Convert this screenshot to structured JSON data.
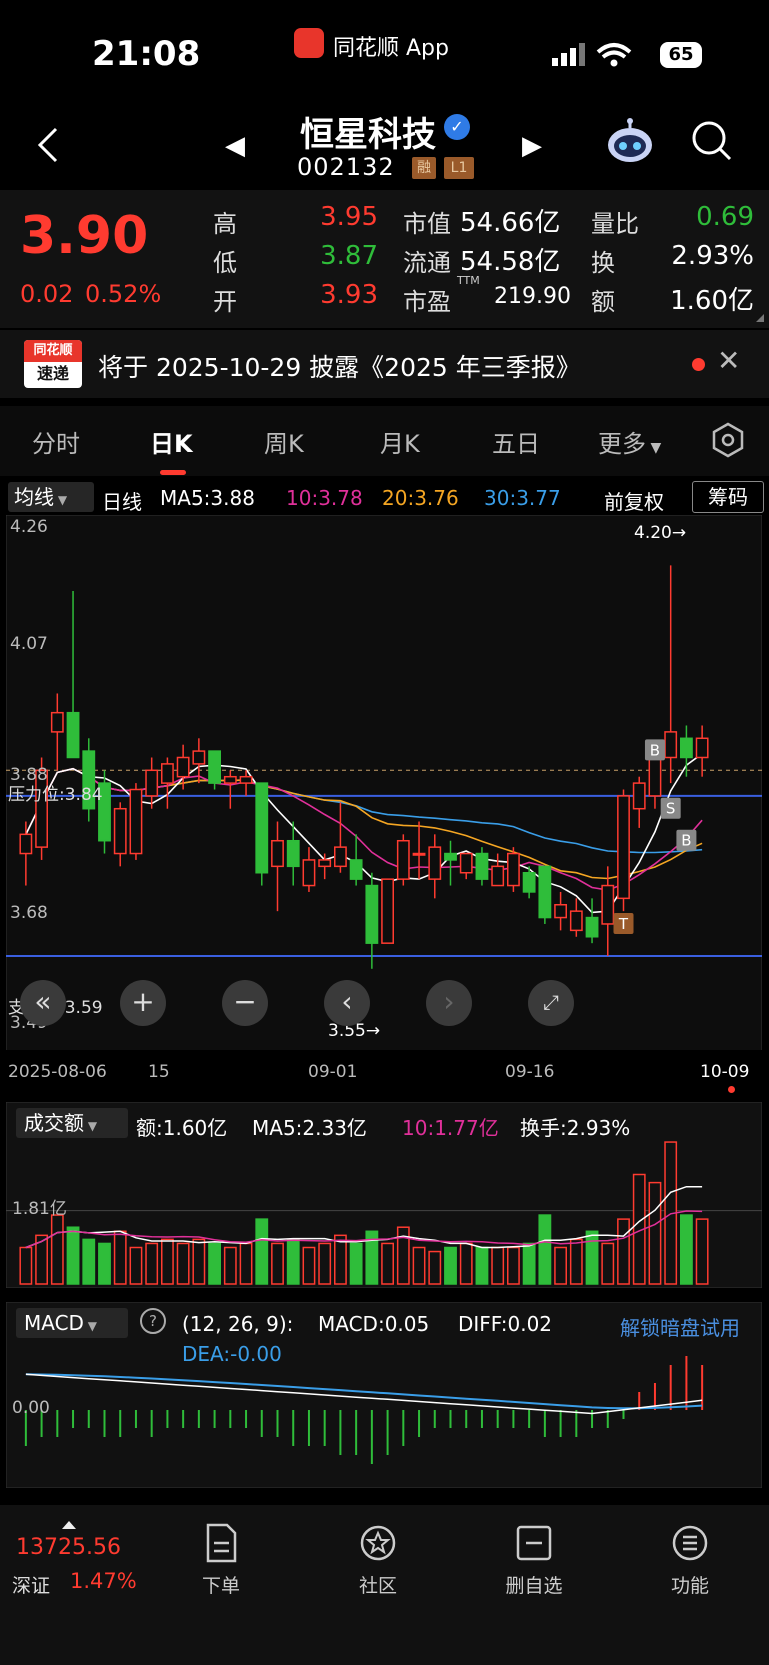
{
  "status_bar": {
    "time": "21:08",
    "app_name": "同花顺 App",
    "battery": "65"
  },
  "header": {
    "stock_name": "恒星科技",
    "stock_code": "002132",
    "tags": [
      "融",
      "L1"
    ]
  },
  "quote": {
    "last_price": "3.90",
    "change": "0.02",
    "change_pct": "0.52%",
    "high_label": "高",
    "high": "3.95",
    "low_label": "低",
    "low": "3.87",
    "open_label": "开",
    "open": "3.93",
    "mktcap_label": "市值",
    "mktcap": "54.66亿",
    "float_label": "流通",
    "float": "54.58亿",
    "pe_label": "市盈",
    "pe_sup": "TTM",
    "pe": "219.90",
    "volratio_label": "量比",
    "volratio": "0.69",
    "turnover_label": "换",
    "turnover": "2.93%",
    "amount_label": "额",
    "amount": "1.60亿"
  },
  "notice": {
    "logo_line1": "同花顺",
    "logo_line2": "速递",
    "text": "将于 2025-10-29 披露《2025 年三季报》"
  },
  "tabs": [
    "分时",
    "日K",
    "周K",
    "月K",
    "五日",
    "更多"
  ],
  "ma_legend": {
    "selector": "均线",
    "period": "日线",
    "ma5": "MA5:3.88",
    "ma10": "10:3.78",
    "ma20": "20:3.76",
    "ma30": "30:3.77",
    "adjust": "前复权",
    "chips": "筹码",
    "colors": {
      "ma5": "#ffffff",
      "ma10": "#e0309a",
      "ma20": "#f5a623",
      "ma30": "#3a9ee8"
    }
  },
  "kline": {
    "y_ticks": [
      "4.26",
      "4.07",
      "3.88",
      "3.68",
      "3.49"
    ],
    "resistance_label": "压力位:3.84",
    "support_label": "支撑位:3.59",
    "max_marker": "4.20→",
    "min_marker": "3.55→",
    "x_labels": [
      "2025-08-06",
      "15",
      "09-01",
      "09-16",
      "10-09"
    ],
    "signals": [
      "B",
      "S",
      "B",
      "T"
    ]
  },
  "chart_data": {
    "type": "candlestick",
    "ylim": [
      3.49,
      4.26
    ],
    "resistance": 3.84,
    "support": 3.59,
    "candles": [
      {
        "o": 3.75,
        "h": 3.8,
        "l": 3.7,
        "c": 3.78
      },
      {
        "o": 3.76,
        "h": 3.9,
        "l": 3.74,
        "c": 3.88
      },
      {
        "o": 3.94,
        "h": 4.0,
        "l": 3.88,
        "c": 3.97
      },
      {
        "o": 3.97,
        "h": 4.16,
        "l": 3.9,
        "c": 3.9
      },
      {
        "o": 3.91,
        "h": 3.93,
        "l": 3.8,
        "c": 3.82
      },
      {
        "o": 3.86,
        "h": 3.88,
        "l": 3.75,
        "c": 3.77
      },
      {
        "o": 3.75,
        "h": 3.83,
        "l": 3.73,
        "c": 3.82
      },
      {
        "o": 3.75,
        "h": 3.86,
        "l": 3.74,
        "c": 3.85
      },
      {
        "o": 3.84,
        "h": 3.9,
        "l": 3.82,
        "c": 3.88
      },
      {
        "o": 3.86,
        "h": 3.9,
        "l": 3.82,
        "c": 3.89
      },
      {
        "o": 3.87,
        "h": 3.92,
        "l": 3.85,
        "c": 3.9
      },
      {
        "o": 3.89,
        "h": 3.93,
        "l": 3.86,
        "c": 3.91
      },
      {
        "o": 3.91,
        "h": 3.91,
        "l": 3.85,
        "c": 3.86
      },
      {
        "o": 3.86,
        "h": 3.88,
        "l": 3.82,
        "c": 3.87
      },
      {
        "o": 3.86,
        "h": 3.88,
        "l": 3.84,
        "c": 3.87
      },
      {
        "o": 3.86,
        "h": 3.86,
        "l": 3.7,
        "c": 3.72
      },
      {
        "o": 3.73,
        "h": 3.8,
        "l": 3.66,
        "c": 3.77
      },
      {
        "o": 3.77,
        "h": 3.8,
        "l": 3.7,
        "c": 3.73
      },
      {
        "o": 3.7,
        "h": 3.76,
        "l": 3.69,
        "c": 3.74
      },
      {
        "o": 3.73,
        "h": 3.75,
        "l": 3.71,
        "c": 3.74
      },
      {
        "o": 3.73,
        "h": 3.83,
        "l": 3.72,
        "c": 3.76
      },
      {
        "o": 3.74,
        "h": 3.78,
        "l": 3.7,
        "c": 3.71
      },
      {
        "o": 3.7,
        "h": 3.72,
        "l": 3.57,
        "c": 3.61
      },
      {
        "o": 3.61,
        "h": 3.71,
        "l": 3.61,
        "c": 3.71
      },
      {
        "o": 3.71,
        "h": 3.78,
        "l": 3.7,
        "c": 3.77
      },
      {
        "o": 3.75,
        "h": 3.8,
        "l": 3.71,
        "c": 3.75
      },
      {
        "o": 3.71,
        "h": 3.78,
        "l": 3.68,
        "c": 3.76
      },
      {
        "o": 3.75,
        "h": 3.77,
        "l": 3.7,
        "c": 3.74
      },
      {
        "o": 3.72,
        "h": 3.75,
        "l": 3.71,
        "c": 3.75
      },
      {
        "o": 3.75,
        "h": 3.76,
        "l": 3.7,
        "c": 3.71
      },
      {
        "o": 3.7,
        "h": 3.75,
        "l": 3.7,
        "c": 3.73
      },
      {
        "o": 3.7,
        "h": 3.76,
        "l": 3.69,
        "c": 3.75
      },
      {
        "o": 3.72,
        "h": 3.73,
        "l": 3.68,
        "c": 3.69
      },
      {
        "o": 3.73,
        "h": 3.73,
        "l": 3.64,
        "c": 3.65
      },
      {
        "o": 3.65,
        "h": 3.69,
        "l": 3.63,
        "c": 3.67
      },
      {
        "o": 3.63,
        "h": 3.68,
        "l": 3.62,
        "c": 3.66
      },
      {
        "o": 3.65,
        "h": 3.68,
        "l": 3.61,
        "c": 3.62
      },
      {
        "o": 3.64,
        "h": 3.73,
        "l": 3.59,
        "c": 3.7
      },
      {
        "o": 3.68,
        "h": 3.85,
        "l": 3.66,
        "c": 3.84
      },
      {
        "o": 3.82,
        "h": 3.87,
        "l": 3.79,
        "c": 3.86
      },
      {
        "o": 3.84,
        "h": 3.91,
        "l": 3.82,
        "c": 3.9
      },
      {
        "o": 3.9,
        "h": 4.2,
        "l": 3.86,
        "c": 3.94
      },
      {
        "o": 3.93,
        "h": 3.95,
        "l": 3.87,
        "c": 3.9
      },
      {
        "o": 3.9,
        "h": 3.95,
        "l": 3.87,
        "c": 3.93
      }
    ],
    "volume": [
      0.9,
      1.2,
      1.7,
      1.4,
      1.1,
      1.0,
      1.3,
      0.9,
      1.0,
      1.1,
      1.0,
      1.1,
      1.0,
      0.9,
      1.0,
      1.6,
      1.0,
      1.1,
      0.9,
      1.0,
      1.2,
      1.0,
      1.3,
      1.0,
      1.4,
      0.9,
      0.8,
      0.9,
      1.0,
      0.9,
      0.9,
      0.9,
      1.0,
      1.7,
      0.9,
      1.1,
      1.3,
      1.0,
      1.6,
      2.7,
      2.5,
      3.5,
      1.7,
      1.6
    ],
    "macd_hist": [
      -0.04,
      -0.03,
      -0.03,
      -0.02,
      -0.02,
      -0.03,
      -0.03,
      -0.02,
      -0.03,
      -0.02,
      -0.02,
      -0.02,
      -0.02,
      -0.02,
      -0.02,
      -0.03,
      -0.03,
      -0.04,
      -0.04,
      -0.04,
      -0.05,
      -0.05,
      -0.06,
      -0.05,
      -0.04,
      -0.03,
      -0.02,
      -0.02,
      -0.02,
      -0.02,
      -0.02,
      -0.02,
      -0.02,
      -0.03,
      -0.03,
      -0.03,
      -0.02,
      -0.02,
      -0.01,
      0.02,
      0.03,
      0.05,
      0.06,
      0.05
    ]
  },
  "volume_panel": {
    "selector": "成交额",
    "amount": "额:1.60亿",
    "ma5": "MA5:2.33亿",
    "ma10": "10:1.77亿",
    "turnover": "换手:2.93%",
    "y_tick": "1.81亿"
  },
  "macd_panel": {
    "selector": "MACD",
    "params": "(12, 26, 9):",
    "macd": "MACD:0.05",
    "diff": "DIFF:0.02",
    "dea": "DEA:-0.00",
    "unlock": "解锁暗盘试用",
    "y_tick": "0.00"
  },
  "bottom_nav": {
    "index_value": "13725.56",
    "index_name": "深证",
    "index_pct": "1.47%",
    "items": [
      "下单",
      "社区",
      "删自选",
      "功能"
    ]
  }
}
